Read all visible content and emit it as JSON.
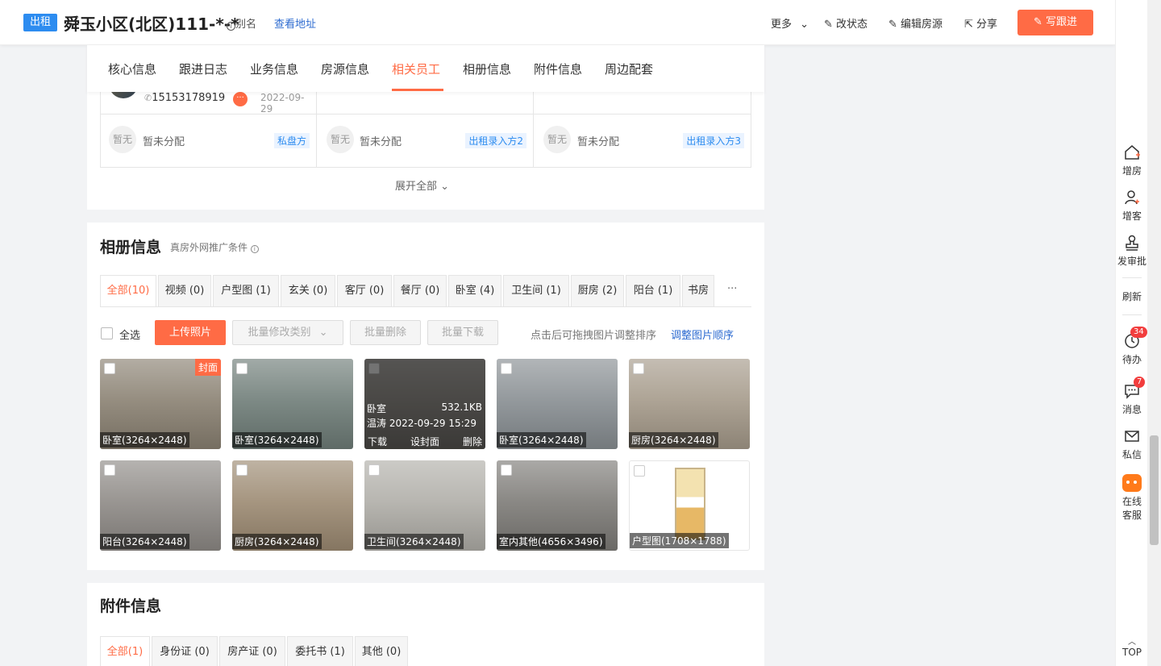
{
  "header": {
    "rent_badge": "出租",
    "title": "舜玉小区(北区)111-*-*",
    "alias_label": "别名",
    "view_address": "查看地址",
    "more": "更多",
    "change_status": "改状态",
    "edit_listing": "编辑房源",
    "share": "分享",
    "write_followup": "写跟进"
  },
  "tabs": [
    "核心信息",
    "跟进日志",
    "业务信息",
    "房源信息",
    "相关员工",
    "相册信息",
    "附件信息",
    "周边配套"
  ],
  "active_tab": "相关员工",
  "employees": {
    "phone": "15153178919",
    "date": "2022-09-29",
    "unassigned": [
      {
        "avatar": "暂无",
        "name": "暂未分配",
        "role": "私盘方"
      },
      {
        "avatar": "暂无",
        "name": "暂未分配",
        "role": "出租录入方2"
      },
      {
        "avatar": "暂无",
        "name": "暂未分配",
        "role": "出租录入方3"
      }
    ],
    "expand_all": "展开全部"
  },
  "album": {
    "title": "相册信息",
    "subtitle": "真房外网推广条件",
    "categories": [
      "全部(10)",
      "视频 (0)",
      "户型图 (1)",
      "玄关 (0)",
      "客厅 (0)",
      "餐厅 (0)",
      "卧室 (4)",
      "卫生间 (1)",
      "厨房 (2)",
      "阳台 (1)",
      "书房"
    ],
    "more_categories": "···",
    "select_all": "全选",
    "upload": "上传照片",
    "batch_edit": "批量修改类别",
    "batch_delete": "批量删除",
    "batch_download": "批量下载",
    "hint": "点击后可拖拽图片调整排序",
    "reorder": "调整图片顺序",
    "cover_label": "封面",
    "photos": [
      {
        "label": "卧室(3264×2448)",
        "color": "#8a8172"
      },
      {
        "label": "卧室(3264×2448)",
        "color": "#6f7d78"
      },
      {
        "label": "卧室(3264×2448)",
        "color": "#9a9690"
      },
      {
        "label": "卧室(3264×2448)",
        "color": "#888e92"
      },
      {
        "label": "厨房(3264×2448)",
        "color": "#a59a8a"
      },
      {
        "label": "阳台(3264×2448)",
        "color": "#8e8a86"
      },
      {
        "label": "厨房(3264×2448)",
        "color": "#9c8a72"
      },
      {
        "label": "卫生间(3264×2448)",
        "color": "#b0aea8"
      },
      {
        "label": "室内其他(4656×3496)",
        "color": "#7d7b77"
      },
      {
        "label": "户型图(1708×1788)",
        "color": "#ffffff"
      }
    ],
    "hover": {
      "type": "卧室",
      "size": "532.1KB",
      "uploader": "温涛 2022-09-29 15:29",
      "download": "下载",
      "set_cover": "设封面",
      "delete": "删除"
    }
  },
  "attachments": {
    "title": "附件信息",
    "categories": [
      "全部(1)",
      "身份证 (0)",
      "房产证 (0)",
      "委托书 (1)",
      "其他 (0)"
    ]
  },
  "sidebar": {
    "add_house": "增房",
    "add_client": "增客",
    "approval": "发审批",
    "refresh": "刷新",
    "todo": "待办",
    "todo_count": "34",
    "messages": "消息",
    "messages_count": "7",
    "private_msg": "私信",
    "online_service_1": "在线",
    "online_service_2": "客服",
    "top": "TOP"
  },
  "colors": {
    "accent": "#ff6b45",
    "link": "#2d6bd0",
    "badge_blue": "#2d8cf0"
  }
}
